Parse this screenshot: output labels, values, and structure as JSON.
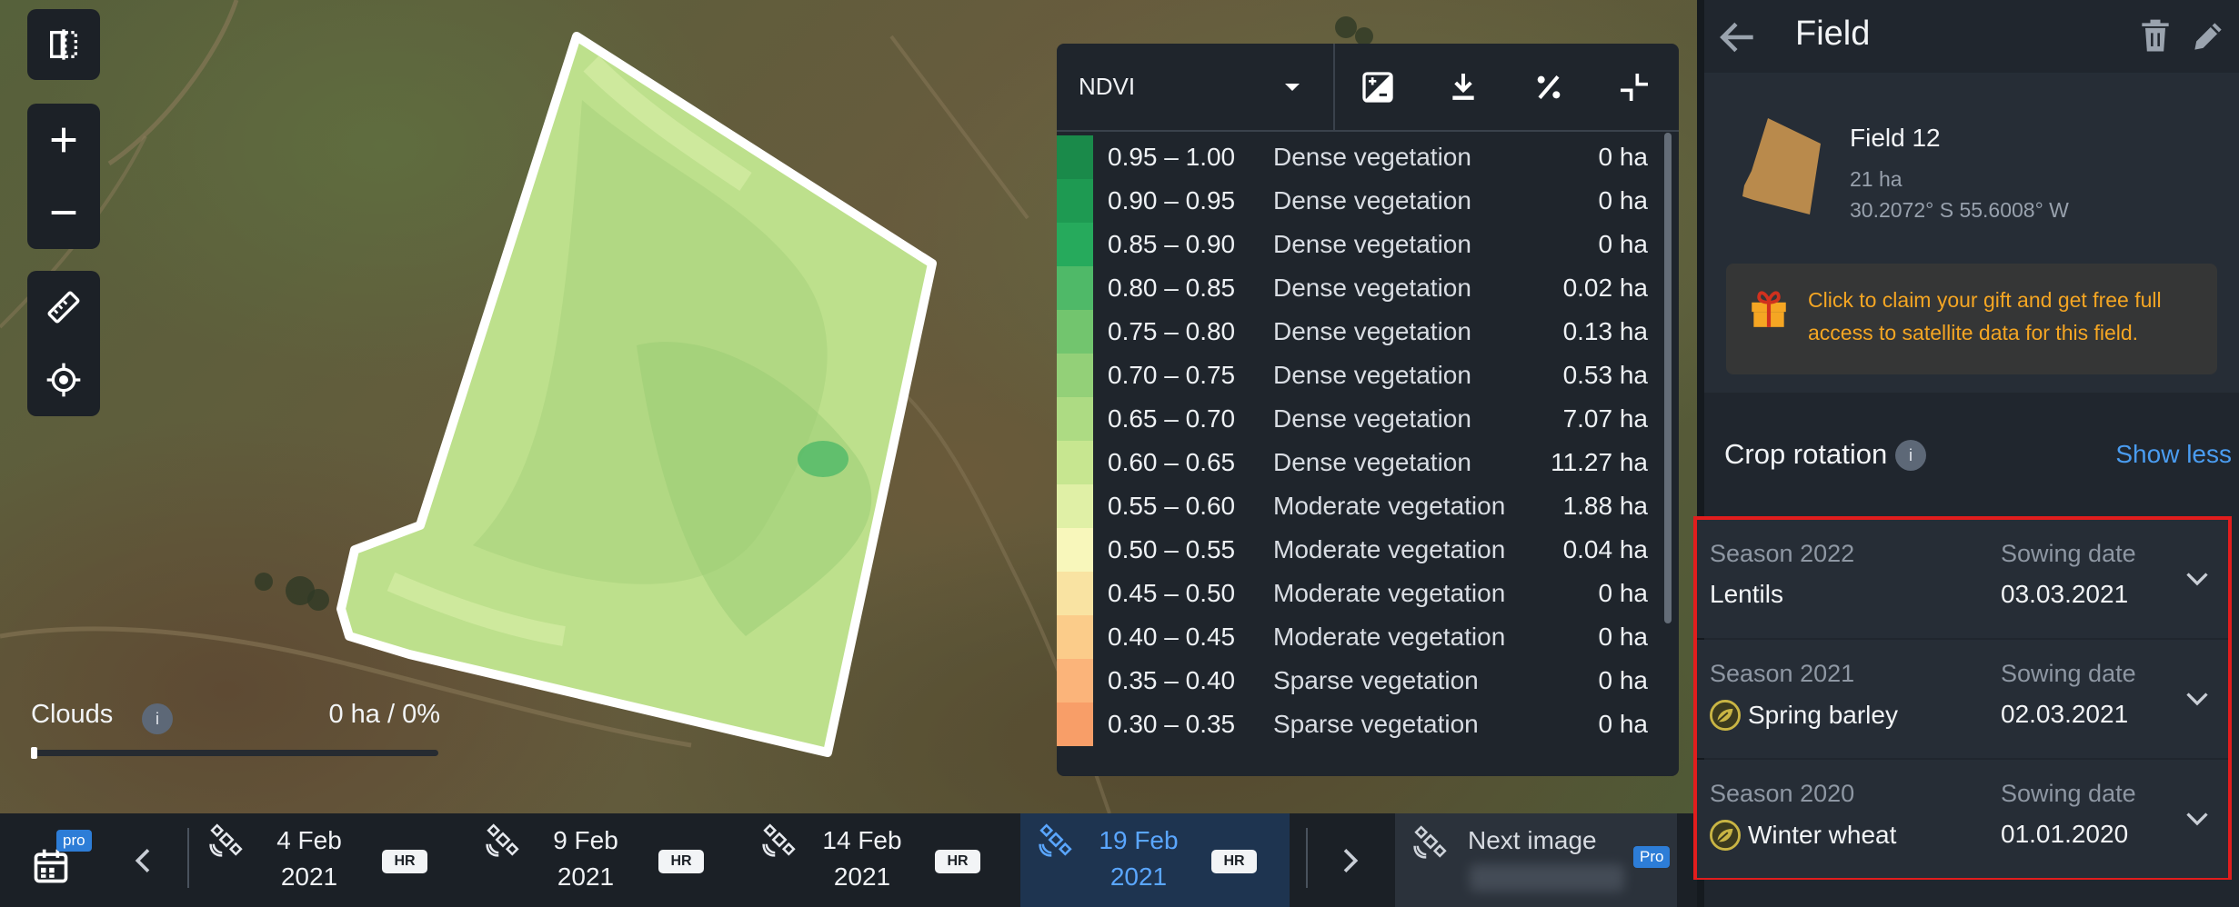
{
  "map": {
    "clouds": {
      "label": "Clouds",
      "info": "i",
      "value": "0 ha / 0%",
      "percent": 0
    }
  },
  "legend": {
    "index_name": "NDVI",
    "rows": [
      {
        "range": "0.95 – 1.00",
        "desc": "Dense vegetation",
        "area": "0 ha",
        "color": "#1a8a4a"
      },
      {
        "range": "0.90 – 0.95",
        "desc": "Dense vegetation",
        "area": "0 ha",
        "color": "#1e9a52"
      },
      {
        "range": "0.85 – 0.90",
        "desc": "Dense vegetation",
        "area": "0 ha",
        "color": "#26aa5c"
      },
      {
        "range": "0.80 – 0.85",
        "desc": "Dense vegetation",
        "area": "0.02 ha",
        "color": "#4fb968"
      },
      {
        "range": "0.75 – 0.80",
        "desc": "Dense vegetation",
        "area": "0.13 ha",
        "color": "#72c56e"
      },
      {
        "range": "0.70 – 0.75",
        "desc": "Dense vegetation",
        "area": "0.53 ha",
        "color": "#93d078"
      },
      {
        "range": "0.65 – 0.70",
        "desc": "Dense vegetation",
        "area": "7.07 ha",
        "color": "#addb83"
      },
      {
        "range": "0.60 – 0.65",
        "desc": "Dense vegetation",
        "area": "11.27 ha",
        "color": "#c7e690"
      },
      {
        "range": "0.55 – 0.60",
        "desc": "Moderate vegetation",
        "area": "1.88 ha",
        "color": "#e0f0a6"
      },
      {
        "range": "0.50 – 0.55",
        "desc": "Moderate vegetation",
        "area": "0.04 ha",
        "color": "#f8f7bb"
      },
      {
        "range": "0.45 – 0.50",
        "desc": "Moderate vegetation",
        "area": "0 ha",
        "color": "#f9e3a2"
      },
      {
        "range": "0.40 – 0.45",
        "desc": "Moderate vegetation",
        "area": "0 ha",
        "color": "#fbcc8a"
      },
      {
        "range": "0.35 – 0.40",
        "desc": "Sparse vegetation",
        "area": "0 ha",
        "color": "#fbb47a"
      },
      {
        "range": "0.30 – 0.35",
        "desc": "Sparse vegetation",
        "area": "0 ha",
        "color": "#f89e68"
      }
    ],
    "tools": [
      "compare-icon",
      "download-icon",
      "percent-icon",
      "collapse-icon"
    ]
  },
  "timeline": {
    "calendar_pro": "pro",
    "dates": [
      {
        "day": "4 Feb",
        "year": "2021",
        "badge": "HR",
        "active": false
      },
      {
        "day": "9 Feb",
        "year": "2021",
        "badge": "HR",
        "active": false
      },
      {
        "day": "14 Feb",
        "year": "2021",
        "badge": "HR",
        "active": false
      },
      {
        "day": "19 Feb",
        "year": "2021",
        "badge": "HR",
        "active": true
      }
    ],
    "next_image": {
      "label": "Next image",
      "badge": "Pro"
    }
  },
  "panel": {
    "title": "Field",
    "field": {
      "name": "Field 12",
      "area": "21 ha",
      "coords": "30.2072° S 55.6008° W",
      "thumb_color": "#b98a4c"
    },
    "gift": {
      "text": "Click to claim your gift and get free full access to satellite data for this field."
    },
    "crop_rotation": {
      "title": "Crop rotation",
      "info": "i",
      "toggle": "Show less",
      "seasons": [
        {
          "season": "Season 2022",
          "crop": "Lentils",
          "has_icon": false,
          "sowing_label": "Sowing date",
          "sowing_date": "03.03.2021"
        },
        {
          "season": "Season 2021",
          "crop": "Spring barley",
          "has_icon": true,
          "sowing_label": "Sowing date",
          "sowing_date": "02.03.2021"
        },
        {
          "season": "Season 2020",
          "crop": "Winter wheat",
          "has_icon": true,
          "sowing_label": "Sowing date",
          "sowing_date": "01.01.2020"
        }
      ]
    }
  }
}
